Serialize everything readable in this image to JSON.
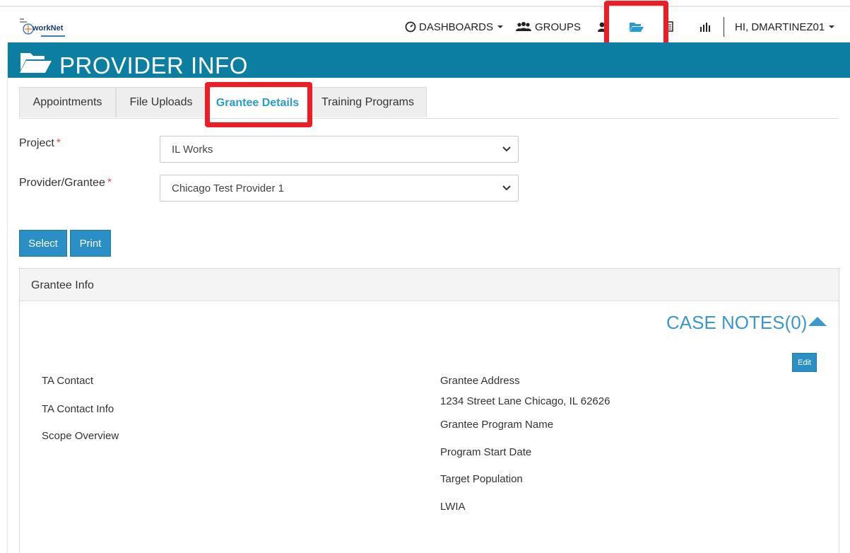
{
  "logo": {
    "brand": "workNet"
  },
  "nav": {
    "dashboards": "DASHBOARDS",
    "groups": "GROUPS",
    "user": "HI, DMARTINEZ01"
  },
  "header": {
    "title": "PROVIDER INFO"
  },
  "tabs": [
    {
      "label": "Appointments"
    },
    {
      "label": "File Uploads"
    },
    {
      "label": "Grantee Details",
      "active": true
    },
    {
      "label": "Training Programs"
    }
  ],
  "form": {
    "project_label": "Project",
    "project_value": "IL Works",
    "provider_label": "Provider/Grantee",
    "provider_value": "Chicago Test Provider 1",
    "required_mark": "*",
    "select_button": "Select",
    "print_button": "Print"
  },
  "panel": {
    "title": "Grantee Info",
    "case_notes": "CASE NOTES(0)",
    "edit_button": "Edit",
    "left_fields": [
      "TA Contact",
      "TA Contact Info",
      "Scope Overview"
    ],
    "address_label": "Grantee Address",
    "address_value": "1234 Street Lane Chicago, IL 62626",
    "right_fields": [
      "Grantee Program Name",
      "Program Start Date",
      "Target Population",
      "LWIA"
    ]
  },
  "colors": {
    "accent": "#0b7ea1",
    "button": "#2a8fc4",
    "active_tab": "#2a9bd1",
    "highlight": "#ee1c25",
    "required": "#d9534f"
  }
}
